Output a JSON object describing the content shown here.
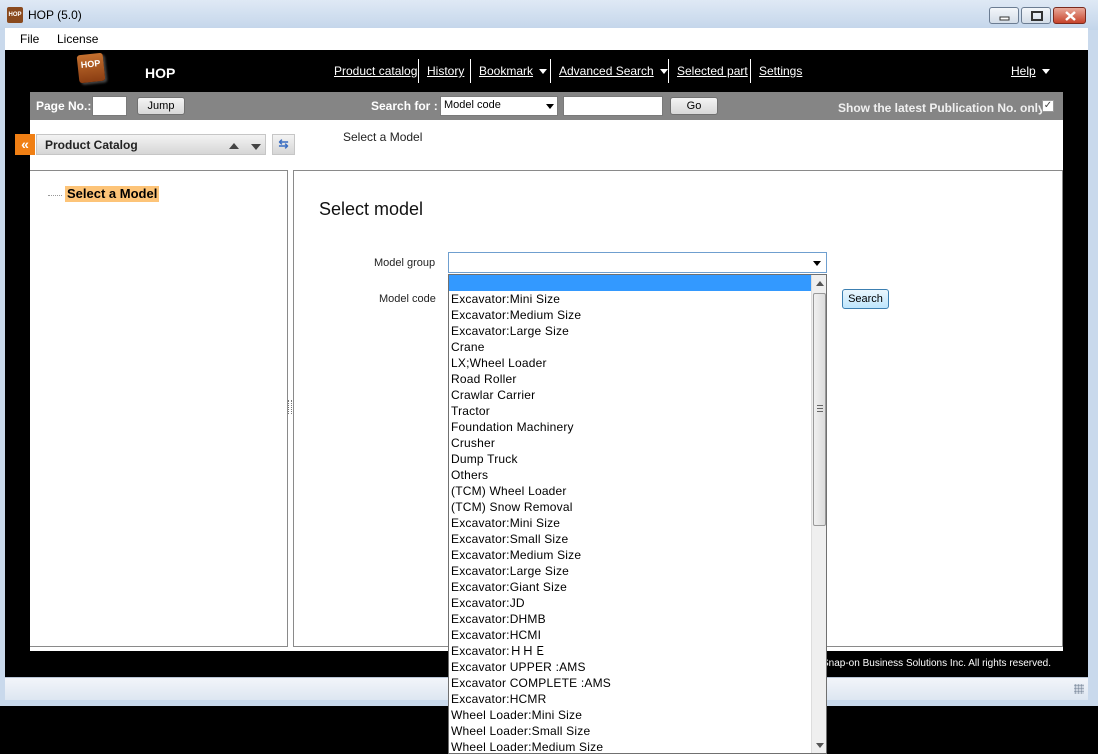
{
  "window": {
    "title": "HOP (5.0)",
    "app_icon": "HOP"
  },
  "menubar": {
    "items": [
      "File",
      "License"
    ]
  },
  "brand": {
    "logo_text": "HOP",
    "name": "HOP"
  },
  "nav": {
    "product_catalog": "Product catalog",
    "history": "History",
    "bookmark": "Bookmark",
    "advanced_search": "Advanced Search",
    "selected_part": "Selected part",
    "settings": "Settings",
    "help": "Help"
  },
  "toolbar": {
    "page_no_label": "Page No.:",
    "page_no_value": "",
    "jump_label": "Jump",
    "search_for_label": "Search for :",
    "search_for_selected": "Model code",
    "search_value": "",
    "go_label": "Go",
    "latest_label": "Show the latest Publication No. only",
    "latest_checked": true
  },
  "catalog_panel": {
    "title": "Product Catalog",
    "collapse_icon": "«",
    "sync_icon": "⇆"
  },
  "breadcrumb": "Select a Model",
  "tree": {
    "selected_node": "Select a Model"
  },
  "main": {
    "heading": "Select model",
    "model_group_label": "Model group",
    "model_group_value": "",
    "model_code_label": "Model code",
    "search_label": "Search"
  },
  "footer": {
    "copyright": "Snap-on Business Solutions Inc. All rights reserved."
  },
  "dropdown": {
    "selected_index": 0,
    "options": [
      "",
      "Excavator:Mini Size",
      "Excavator:Medium Size",
      "Excavator:Large Size",
      "Crane",
      "LX;Wheel Loader",
      "Road Roller",
      "Crawlar Carrier",
      "Tractor",
      "Foundation Machinery",
      "Crusher",
      "Dump Truck",
      "Others",
      "(TCM) Wheel Loader",
      "(TCM) Snow Removal",
      "Excavator:Mini Size",
      "Excavator:Small Size",
      "Excavator:Medium Size",
      "Excavator:Large Size",
      "Excavator:Giant Size",
      "Excavator:JD",
      "Excavator:DHMB",
      "Excavator:HCMI",
      "Excavator:ＨＨＥ",
      "Excavator UPPER :AMS",
      "Excavator COMPLETE :AMS",
      "Excavator:HCMR",
      "Wheel Loader:Mini Size",
      "Wheel Loader:Small Size",
      "Wheel Loader:Medium Size"
    ]
  },
  "colors": {
    "accent_orange": "#f07f14",
    "selection_blue": "#3399ff",
    "tree_highlight": "#fdc478",
    "toolbar_gray": "#858585"
  }
}
